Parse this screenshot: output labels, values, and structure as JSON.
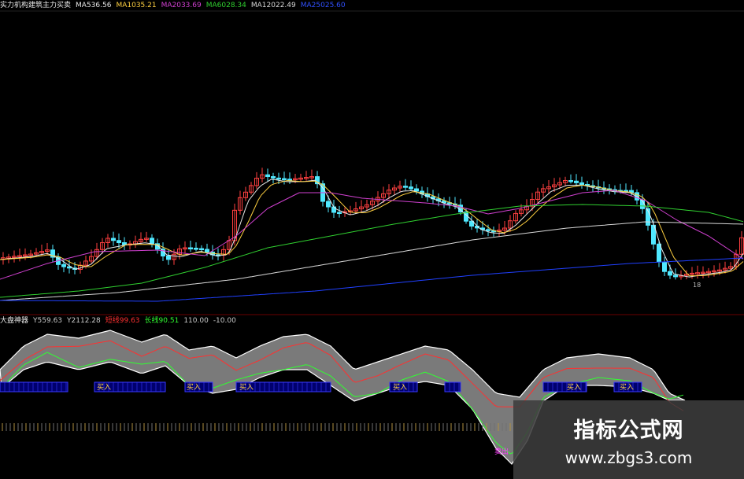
{
  "main_legend": {
    "title": "实力机构建筑主力买卖",
    "items": [
      {
        "label": "MA5",
        "value": "36.56",
        "color": "#e8e8e8"
      },
      {
        "label": "MA10",
        "value": "35.21",
        "color": "#ffd040"
      },
      {
        "label": "MA20",
        "value": "33.69",
        "color": "#d040d0"
      },
      {
        "label": "MA60",
        "value": "28.34",
        "color": "#30d030"
      },
      {
        "label": "MA120",
        "value": "22.49",
        "color": "#d8d8d8"
      },
      {
        "label": "MA250",
        "value": "25.60",
        "color": "#3050ff"
      }
    ]
  },
  "indicator_legend": {
    "title": "大盘神器",
    "items": [
      {
        "label": "Y5",
        "value": "59.63",
        "color": "#c8c8c8"
      },
      {
        "label": "Y2",
        "value": "112.28",
        "color": "#c8c8c8"
      },
      {
        "label": "短线",
        "value": "99.63",
        "color": "#ff3030"
      },
      {
        "label": "长线",
        "value": "90.51",
        "color": "#30ff30"
      },
      {
        "label": "",
        "value": "110.00",
        "color": "#c8c8c8"
      },
      {
        "label": "",
        "value": "-10.00",
        "color": "#c8c8c8"
      }
    ]
  },
  "tags": [
    {
      "text": "买入",
      "color": "#ffd040"
    },
    {
      "text": "买入",
      "color": "#ffd040"
    },
    {
      "text": "买入",
      "color": "#ffd040"
    },
    {
      "text": "买入",
      "color": "#ffd040"
    },
    {
      "text": "买入",
      "color": "#ffd040"
    },
    {
      "text": "买入",
      "color": "#ffd040"
    },
    {
      "text": "卖出",
      "color": "#ff40ff"
    }
  ],
  "price_label": "18",
  "watermark": {
    "title": "指标公式网",
    "url": "www.zbgs3.com"
  }
}
